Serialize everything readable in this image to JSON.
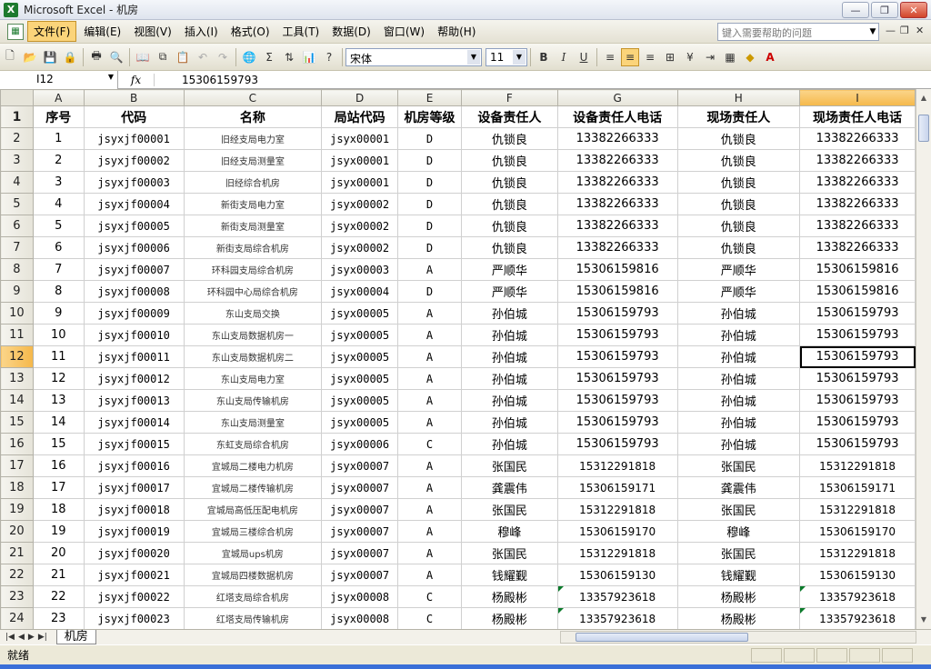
{
  "window": {
    "title": "Microsoft Excel - 机房",
    "app_icon": "excel-icon"
  },
  "menu": {
    "items": [
      "文件(F)",
      "编辑(E)",
      "视图(V)",
      "插入(I)",
      "格式(O)",
      "工具(T)",
      "数据(D)",
      "窗口(W)",
      "帮助(H)"
    ],
    "active_index": 0,
    "help_placeholder": "键入需要帮助的问题"
  },
  "toolbar": {
    "font": "宋体",
    "size": "11"
  },
  "formula_bar": {
    "name_box": "I12",
    "fx": "fx",
    "value": "15306159793"
  },
  "sheet": {
    "columns": [
      "A",
      "B",
      "C",
      "D",
      "E",
      "F",
      "G",
      "H",
      "I"
    ],
    "selected_column": "I",
    "selected_row": 12,
    "header": [
      "序号",
      "代码",
      "名称",
      "局站代码",
      "机房等级",
      "设备责任人",
      "设备责任人电话",
      "现场责任人",
      "现场责任人电话"
    ],
    "rows": [
      [
        "1",
        "jsyxjf00001",
        "旧经支局电力室",
        "jsyx00001",
        "D",
        "仇锁良",
        "13382266333",
        "仇锁良",
        "13382266333"
      ],
      [
        "2",
        "jsyxjf00002",
        "旧经支局测量室",
        "jsyx00001",
        "D",
        "仇锁良",
        "13382266333",
        "仇锁良",
        "13382266333"
      ],
      [
        "3",
        "jsyxjf00003",
        "旧经综合机房",
        "jsyx00001",
        "D",
        "仇锁良",
        "13382266333",
        "仇锁良",
        "13382266333"
      ],
      [
        "4",
        "jsyxjf00004",
        "新街支局电力室",
        "jsyx00002",
        "D",
        "仇锁良",
        "13382266333",
        "仇锁良",
        "13382266333"
      ],
      [
        "5",
        "jsyxjf00005",
        "新街支局测量室",
        "jsyx00002",
        "D",
        "仇锁良",
        "13382266333",
        "仇锁良",
        "13382266333"
      ],
      [
        "6",
        "jsyxjf00006",
        "新街支局综合机房",
        "jsyx00002",
        "D",
        "仇锁良",
        "13382266333",
        "仇锁良",
        "13382266333"
      ],
      [
        "7",
        "jsyxjf00007",
        "环科园支局综合机房",
        "jsyx00003",
        "A",
        "严顺华",
        "15306159816",
        "严顺华",
        "15306159816"
      ],
      [
        "8",
        "jsyxjf00008",
        "环科园中心局综合机房",
        "jsyx00004",
        "D",
        "严顺华",
        "15306159816",
        "严顺华",
        "15306159816"
      ],
      [
        "9",
        "jsyxjf00009",
        "东山支局交换",
        "jsyx00005",
        "A",
        "孙伯城",
        "15306159793",
        "孙伯城",
        "15306159793"
      ],
      [
        "10",
        "jsyxjf00010",
        "东山支局数据机房一",
        "jsyx00005",
        "A",
        "孙伯城",
        "15306159793",
        "孙伯城",
        "15306159793"
      ],
      [
        "11",
        "jsyxjf00011",
        "东山支局数据机房二",
        "jsyx00005",
        "A",
        "孙伯城",
        "15306159793",
        "孙伯城",
        "15306159793"
      ],
      [
        "12",
        "jsyxjf00012",
        "东山支局电力室",
        "jsyx00005",
        "A",
        "孙伯城",
        "15306159793",
        "孙伯城",
        "15306159793"
      ],
      [
        "13",
        "jsyxjf00013",
        "东山支局传输机房",
        "jsyx00005",
        "A",
        "孙伯城",
        "15306159793",
        "孙伯城",
        "15306159793"
      ],
      [
        "14",
        "jsyxjf00014",
        "东山支局测量室",
        "jsyx00005",
        "A",
        "孙伯城",
        "15306159793",
        "孙伯城",
        "15306159793"
      ],
      [
        "15",
        "jsyxjf00015",
        "东虹支局综合机房",
        "jsyx00006",
        "C",
        "孙伯城",
        "15306159793",
        "孙伯城",
        "15306159793"
      ],
      [
        "16",
        "jsyxjf00016",
        "宜城局二楼电力机房",
        "jsyx00007",
        "A",
        "张国民",
        "15312291818",
        "张国民",
        "15312291818"
      ],
      [
        "17",
        "jsyxjf00017",
        "宜城局二楼传输机房",
        "jsyx00007",
        "A",
        "龚震伟",
        "15306159171",
        "龚震伟",
        "15306159171"
      ],
      [
        "18",
        "jsyxjf00018",
        "宜城局高低压配电机房",
        "jsyx00007",
        "A",
        "张国民",
        "15312291818",
        "张国民",
        "15312291818"
      ],
      [
        "19",
        "jsyxjf00019",
        "宜城局三楼综合机房",
        "jsyx00007",
        "A",
        "穆峰",
        "15306159170",
        "穆峰",
        "15306159170"
      ],
      [
        "20",
        "jsyxjf00020",
        "宜城局ups机房",
        "jsyx00007",
        "A",
        "张国民",
        "15312291818",
        "张国民",
        "15312291818"
      ],
      [
        "21",
        "jsyxjf00021",
        "宜城局四楼数据机房",
        "jsyx00007",
        "A",
        "钱耀觐",
        "15306159130",
        "钱耀觐",
        "15306159130"
      ],
      [
        "22",
        "jsyxjf00022",
        "红塔支局综合机房",
        "jsyx00008",
        "C",
        "杨殿彬",
        "13357923618",
        "杨殿彬",
        "13357923618"
      ],
      [
        "23",
        "jsyxjf00023",
        "红塔支局传输机房",
        "jsyx00008",
        "C",
        "杨殿彬",
        "13357923618",
        "杨殿彬",
        "13357923618"
      ]
    ]
  },
  "sheet_tab": "机房",
  "status": "就绪"
}
